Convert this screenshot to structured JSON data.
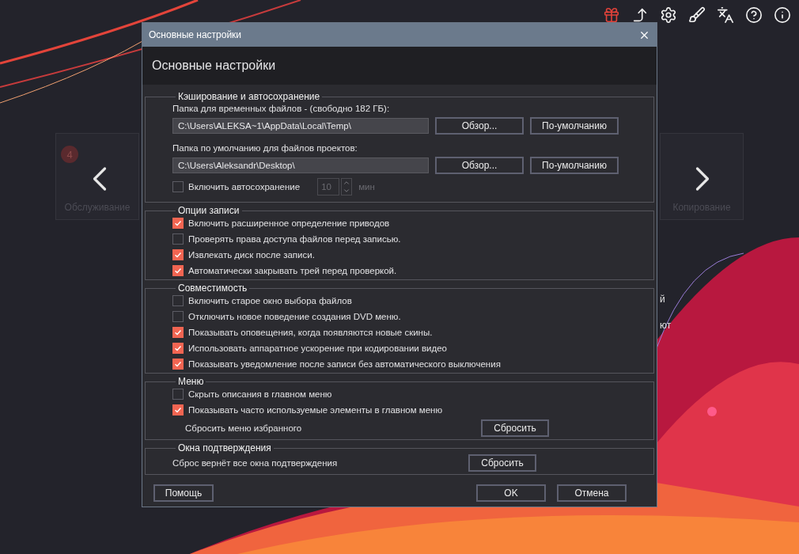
{
  "background": {
    "tiles": [
      {
        "label": "Обслуживание",
        "badge": "4"
      },
      {
        "label": "Копирование"
      }
    ],
    "fragments": [
      "й",
      "ют"
    ]
  },
  "dialog": {
    "title": "Основные настройки",
    "heading": "Основные настройки",
    "cache": {
      "legend": "Кэширование и автосохранение",
      "folders": [
        {
          "label": "Папка для временных файлов - (свободно 182 ГБ):",
          "value": "C:\\Users\\ALEKSA~1\\AppData\\Local\\Temp\\",
          "browse": "Обзор...",
          "default": "По-умолчанию"
        },
        {
          "label": "Папка по умолчанию для файлов проектов:",
          "value": "C:\\Users\\Aleksandr\\Desktop\\",
          "browse": "Обзор...",
          "default": "По-умолчанию"
        }
      ],
      "autosave": {
        "label": "Включить автосохранение",
        "checked": false,
        "value": "10",
        "unit": "мин"
      }
    },
    "groups": [
      {
        "legend": "Опции записи",
        "items": [
          {
            "label": "Включить расширенное определение приводов",
            "checked": true
          },
          {
            "label": "Проверять права доступа файлов перед записью.",
            "checked": false
          },
          {
            "label": "Извлекать диск после записи.",
            "checked": true
          },
          {
            "label": "Автоматически закрывать трей перед проверкой.",
            "checked": true
          }
        ]
      },
      {
        "legend": "Совместимость",
        "items": [
          {
            "label": "Включить старое окно выбора файлов",
            "checked": false
          },
          {
            "label": "Отключить новое поведение создания DVD меню.",
            "checked": false
          },
          {
            "label": "Показывать оповещения, когда появляются новые скины.",
            "checked": true
          },
          {
            "label": "Использовать аппаратное ускорение при кодировании видео",
            "checked": true
          },
          {
            "label": "Показывать уведомление после записи без автоматического выключения",
            "checked": true
          }
        ]
      },
      {
        "legend": "Меню",
        "items": [
          {
            "label": "Скрыть описания в главном меню",
            "checked": false
          },
          {
            "label": "Показывать часто используемые элементы в главном меню",
            "checked": true
          }
        ],
        "reset": {
          "label": "Сбросить меню избранного",
          "button": "Сбросить"
        }
      },
      {
        "legend": "Окна подтверждения",
        "reset": {
          "label": "Сброс вернёт все окна подтверждения",
          "button": "Сбросить"
        }
      }
    ],
    "buttons": {
      "help": "Помощь",
      "ok": "OK",
      "cancel": "Отмена"
    }
  }
}
